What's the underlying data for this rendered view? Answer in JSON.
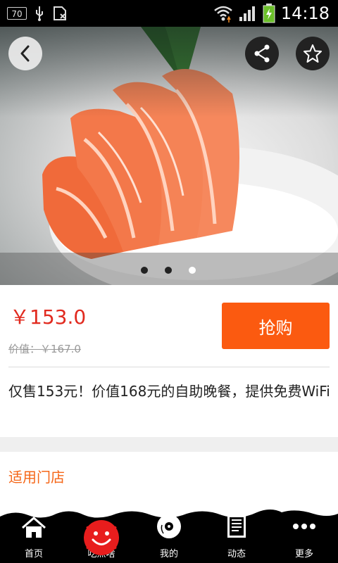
{
  "status_bar": {
    "badge": "70",
    "time": "14:18"
  },
  "hero": {
    "icons": {
      "back": "back-arrow-icon",
      "share": "share-icon",
      "favorite": "star-icon"
    },
    "carousel": {
      "pages": 3,
      "active_page": 3
    }
  },
  "deal": {
    "price": "￥153.0",
    "original_price": "价值：￥167.0",
    "buy_label": "抢购",
    "description": "仅售153元！价值168元的自助晚餐，提供免费WiFi"
  },
  "stores": {
    "title": "适用门店"
  },
  "bottom_nav": {
    "items": [
      {
        "label": "首页",
        "icon": "home-icon"
      },
      {
        "label": "吃点啥",
        "icon": "smiley-icon"
      },
      {
        "label": "我的",
        "icon": "disc-icon"
      },
      {
        "label": "动态",
        "icon": "news-icon"
      },
      {
        "label": "更多",
        "icon": "more-icon"
      }
    ]
  },
  "colors": {
    "price": "#e12a1f",
    "buy_button": "#fb5a10",
    "stores_title": "#f56617",
    "nav_badge": "#e81d1d"
  }
}
